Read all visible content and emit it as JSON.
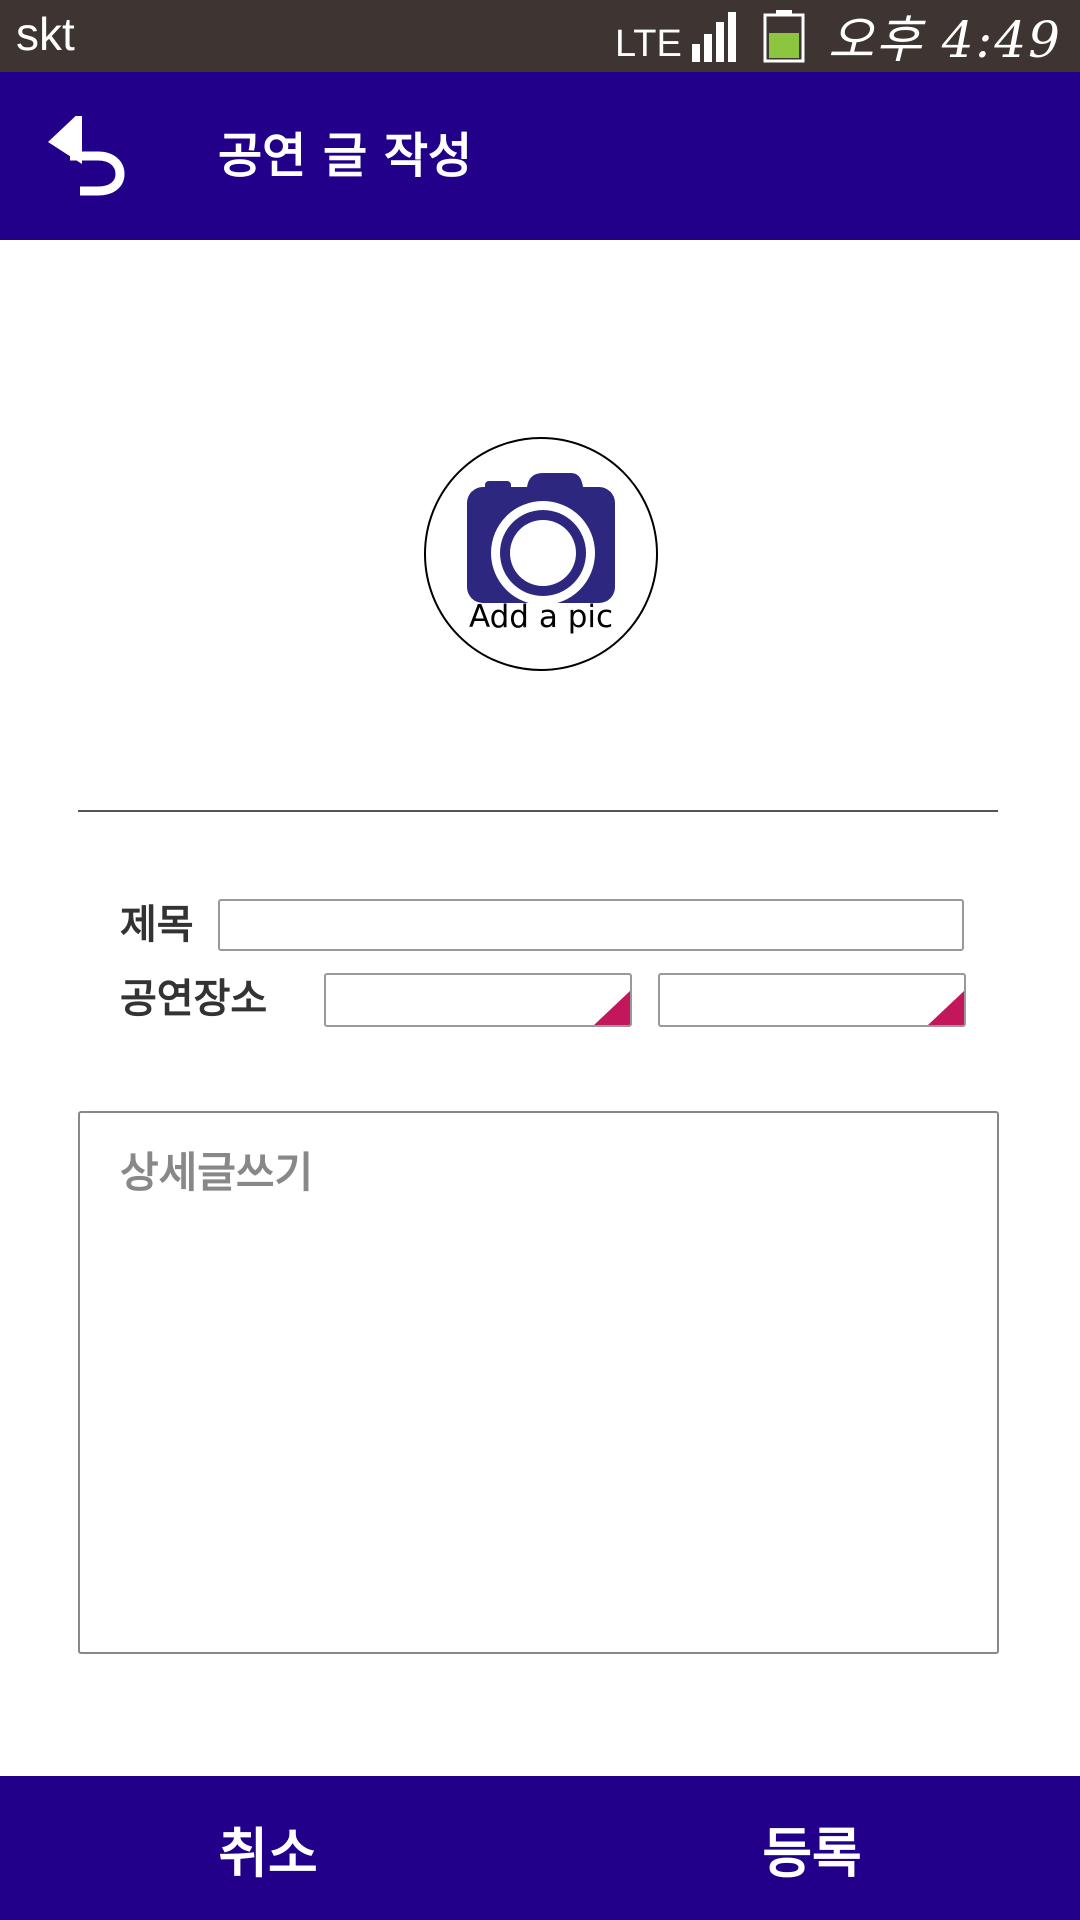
{
  "status_bar": {
    "carrier": "skt",
    "network": "LTE",
    "time": "오후 4:49",
    "battery_color": "#8cc63f",
    "icons": [
      "signal-icon",
      "battery-icon"
    ]
  },
  "app_bar": {
    "title": "공연 글 작성",
    "background": "#22008a",
    "back_icon": "back-arrow-icon"
  },
  "photo": {
    "label": "Add a pic",
    "icon": "camera-icon",
    "icon_color": "#2e2780"
  },
  "form": {
    "title_label": "제목",
    "title_value": "",
    "venue_label": "공연장소",
    "venue_select_1": "",
    "venue_select_2": "",
    "dropdown_accent": "#c2185b",
    "details_placeholder": "상세글쓰기",
    "details_value": ""
  },
  "bottom_bar": {
    "cancel_label": "취소",
    "register_label": "등록"
  }
}
